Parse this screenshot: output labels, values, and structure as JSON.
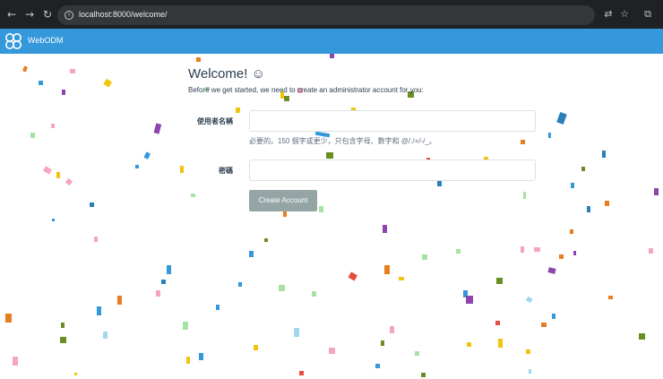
{
  "browser": {
    "url": "localhost:8000/welcome/"
  },
  "app": {
    "name": "WebODM"
  },
  "welcome": {
    "title": "Welcome! ☺",
    "intro": "Before we get started, we need to create an administrator account for you:",
    "username_label": "使用者名稱",
    "username_value": "",
    "username_help": "必要的。150 個字或更少，只包含字母、數字和 @/./+/-/_。",
    "password_label": "密碼",
    "password_value": "",
    "submit_label": "Create Account"
  },
  "colors": {
    "navbar": "#3498db",
    "button": "#95a5a6",
    "text": "#2c3e50"
  }
}
